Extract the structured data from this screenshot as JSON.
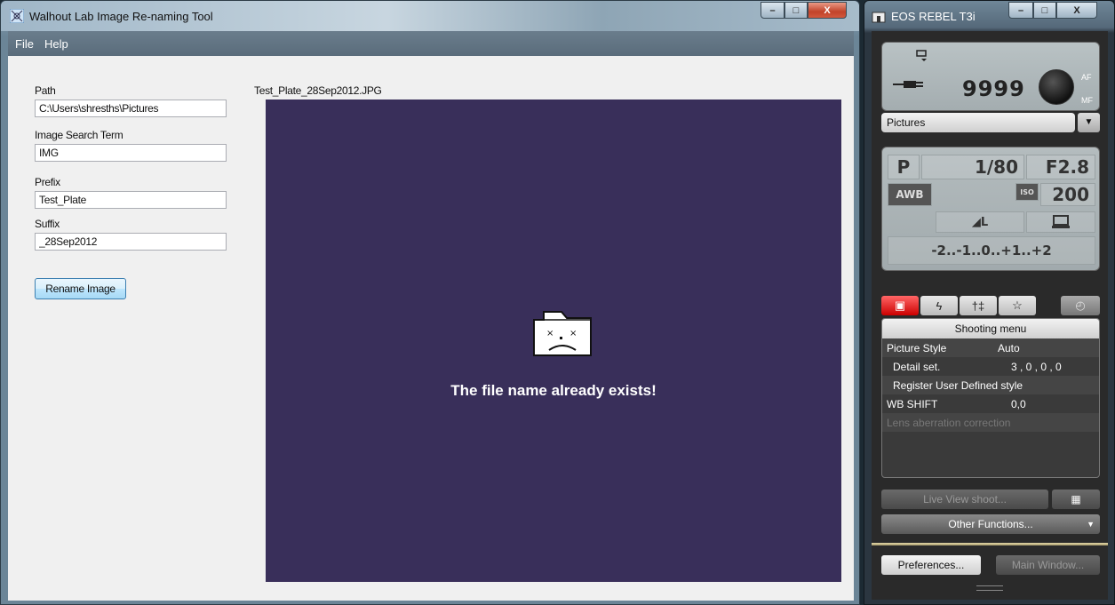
{
  "left_window": {
    "title": "Walhout Lab Image Re-naming Tool",
    "caption_min": "–",
    "caption_max": "□",
    "caption_close": "X",
    "menu": [
      "File",
      "Help"
    ],
    "fields": [
      {
        "label": "Path",
        "value": "C:\\Users\\shresths\\Pictures"
      },
      {
        "label": "Image Search Term",
        "value": "IMG"
      },
      {
        "label": "Prefix",
        "value": "Test_Plate"
      },
      {
        "label": "Suffix",
        "value": "_28Sep2012"
      }
    ],
    "rename_button": "Rename Image",
    "filename": "Test_Plate_28Sep2012.JPG",
    "error_message": "The file name already exists!",
    "viewer_bg": "#392f5a"
  },
  "right_window": {
    "title": "EOS REBEL T3i",
    "lcd": {
      "shots_remaining": "9999",
      "af": "AF",
      "mf": "MF"
    },
    "folder": "Pictures",
    "settings": {
      "mode": "P",
      "shutter": "1/80",
      "aperture": "F2.8",
      "wb": "AWB",
      "iso_label": "ISO",
      "iso": "200",
      "quality": "◢L",
      "exposure_scale": "-2..-1..0..+1..+2"
    },
    "tabs": [
      "camera-tab",
      "flash-tab",
      "tools-tab",
      "mymenu-tab"
    ],
    "tab_glyphs": [
      "▣",
      "ϟ",
      "†‡",
      "☆"
    ],
    "timer_glyph": "◴",
    "menu_title": "Shooting menu",
    "menu_rows": [
      {
        "key": "Picture Style",
        "value": "Auto",
        "indent": false,
        "disabled": false
      },
      {
        "key": "Detail set.",
        "value": "3 , 0 , 0 , 0",
        "indent": true,
        "disabled": false
      },
      {
        "key": "Register User Defined style",
        "value": "",
        "indent": true,
        "disabled": false
      },
      {
        "key": "WB SHIFT",
        "value": "0,0",
        "indent": false,
        "disabled": false
      },
      {
        "key": "Lens aberration correction",
        "value": "",
        "indent": false,
        "disabled": true
      }
    ],
    "live_view_button": "Live View shoot...",
    "other_functions_button": "Other Functions...",
    "other_functions_arrow": "▼",
    "preferences_button": "Preferences...",
    "main_window_button": "Main Window..."
  }
}
